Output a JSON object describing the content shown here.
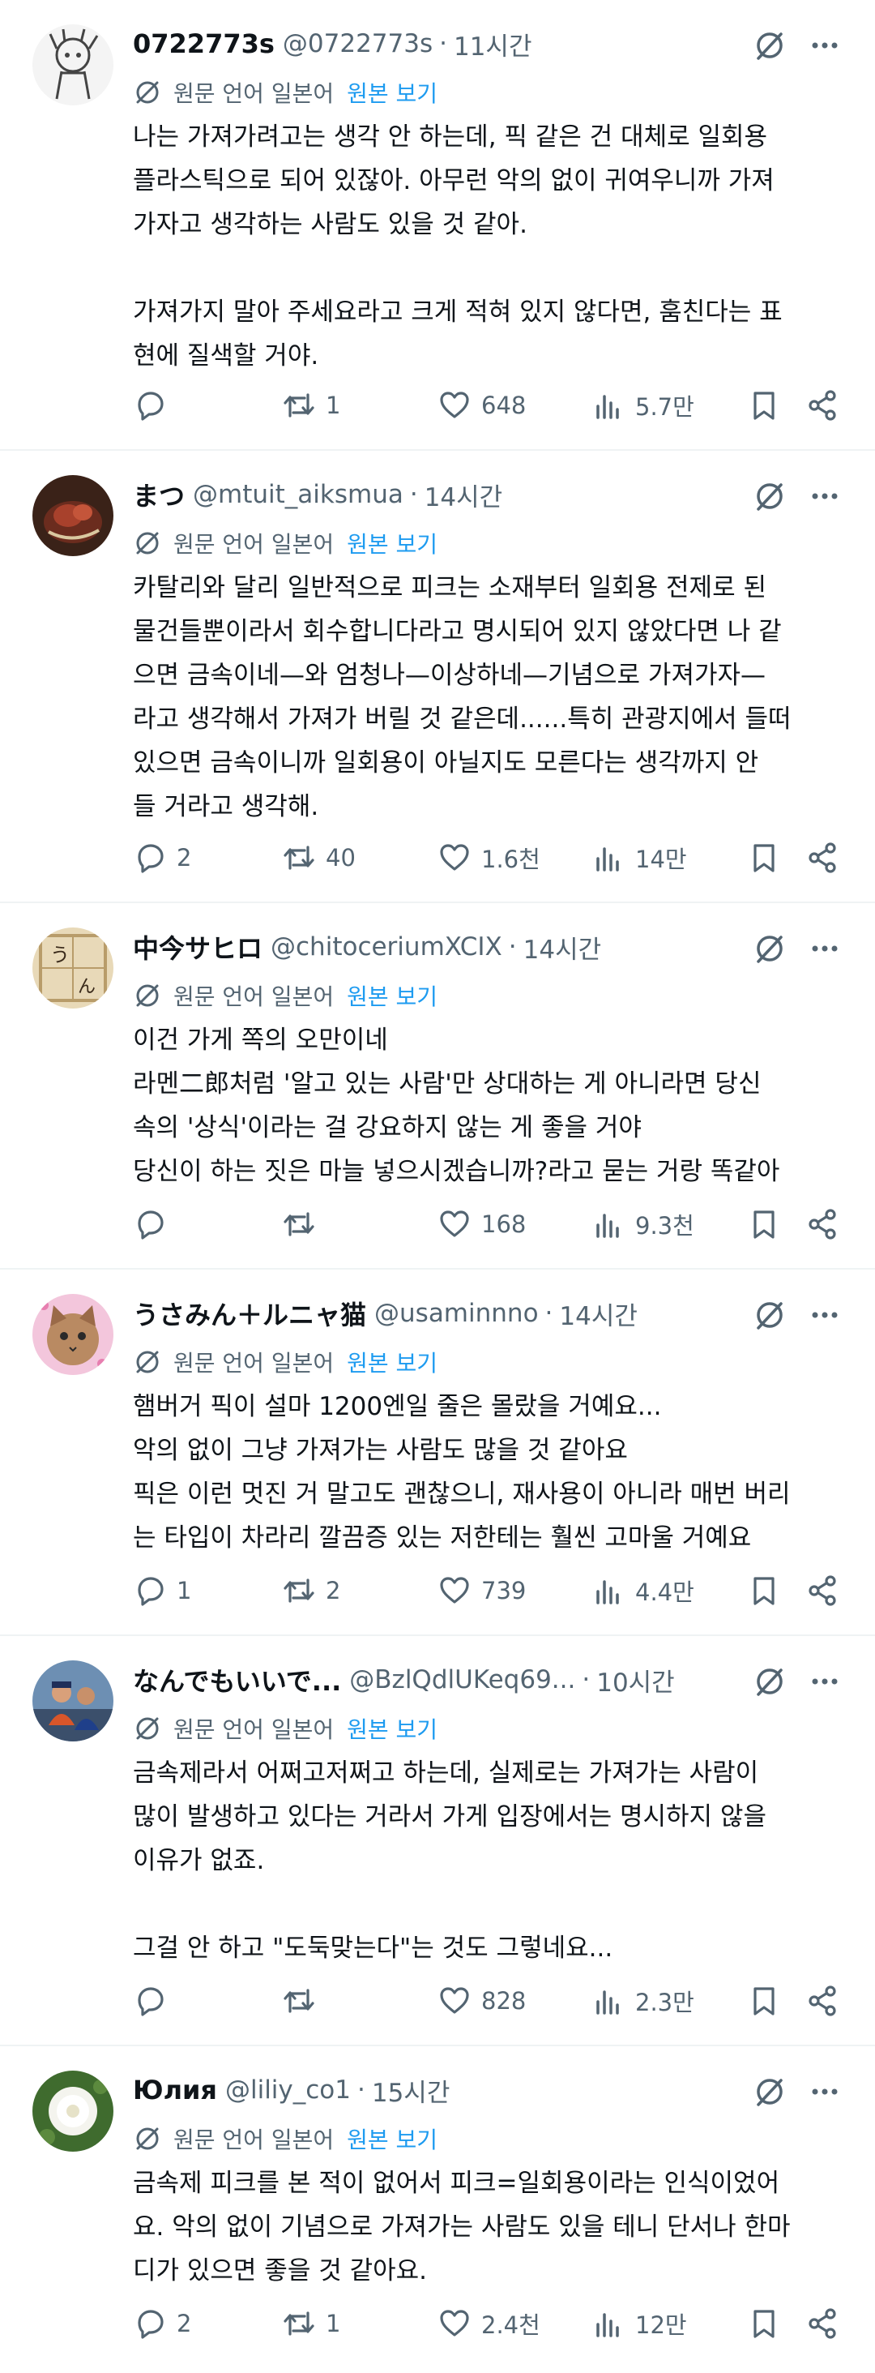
{
  "translate": {
    "label": "원문 언어 일본어",
    "show_original": "원본 보기"
  },
  "tweets": [
    {
      "name": "0722773s",
      "handle": "@0722773s",
      "time": "11시간",
      "text": "나는 가져가려고는 생각 안 하는데, 픽 같은 건 대체로 일회용\n플라스틱으로 되어 있잖아. 아무런 악의 없이 귀여우니까 가져\n가자고 생각하는 사람도 있을 것 같아.\n\n가져가지 말아 주세요라고 크게 적혀 있지 않다면, 훔친다는 표\n현에 질색할 거야.",
      "replies": "",
      "retweets": "1",
      "likes": "648",
      "views": "5.7만"
    },
    {
      "name": "まつ",
      "handle": "@mtuit_aiksmua",
      "time": "14시간",
      "text": "카탈리와 달리 일반적으로 피크는 소재부터 일회용 전제로 된\n물건들뿐이라서 회수합니다라고 명시되어 있지 않았다면 나 같\n으면 금속이네—와 엄청나—이상하네—기념으로 가져가자—\n라고 생각해서 가져가 버릴 것 같은데......특히 관광지에서 들떠\n있으면 금속이니까 일회용이 아닐지도 모른다는 생각까지 안\n들 거라고 생각해.",
      "replies": "2",
      "retweets": "40",
      "likes": "1.6천",
      "views": "14만"
    },
    {
      "name": "中今サヒロ",
      "handle": "@chitoceriumXCIX",
      "time": "14시간",
      "text": "이건 가게 쪽의 오만이네\n라멘二郎처럼 '알고 있는 사람'만 상대하는 게 아니라면 당신\n속의 '상식'이라는 걸 강요하지 않는 게 좋을 거야\n당신이 하는 짓은 마늘 넣으시겠습니까?라고 묻는 거랑 똑같아",
      "replies": "",
      "retweets": "",
      "likes": "168",
      "views": "9.3천"
    },
    {
      "name": "うさみん＋ルニャ猫",
      "handle": "@usaminnno",
      "time": "14시간",
      "text": "햄버거 픽이 설마 1200엔일 줄은 몰랐을 거예요...\n악의 없이 그냥 가져가는 사람도 많을 것 같아요\n픽은 이런 멋진 거 말고도 괜찮으니, 재사용이 아니라 매번 버리\n는 타입이 차라리 깔끔증 있는 저한테는 훨씬 고마울 거예요",
      "replies": "1",
      "retweets": "2",
      "likes": "739",
      "views": "4.4만"
    },
    {
      "name": "なんでもいいで...",
      "handle": "@BzlQdlUKeq69...",
      "time": "10시간",
      "text": "금속제라서 어쩌고저쩌고 하는데, 실제로는 가져가는 사람이\n많이 발생하고 있다는 거라서 가게 입장에서는 명시하지 않을\n이유가 없죠.\n\n그걸 안 하고 \"도둑맞는다\"는 것도 그렇네요...",
      "replies": "",
      "retweets": "",
      "likes": "828",
      "views": "2.3만"
    },
    {
      "name": "Юлия",
      "handle": "@liliy_co1",
      "time": "15시간",
      "text": "금속제 피크를 본 적이 없어서 피크=일회용이라는 인식이었어\n요. 악의 없이 기념으로 가져가는 사람도 있을 테니 단서나 한마\n디가 있으면 좋을 것 같아요.",
      "replies": "2",
      "retweets": "1",
      "likes": "2.4천",
      "views": "12만"
    }
  ]
}
